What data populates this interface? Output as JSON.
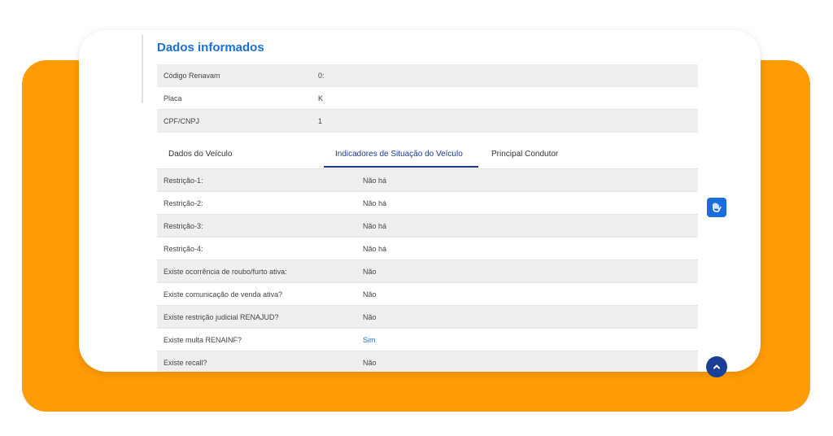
{
  "header": {
    "title": "Dados informados"
  },
  "info_rows": [
    {
      "label": "Código Renavam",
      "value": "0:"
    },
    {
      "label": "Placa",
      "value": "K"
    },
    {
      "label": "CPF/CNPJ",
      "value": "1"
    }
  ],
  "tabs": [
    {
      "label": "Dados do Veículo"
    },
    {
      "label": "Indicadores de Situação do Veículo"
    },
    {
      "label": "Principal Condutor"
    }
  ],
  "indicators": [
    {
      "label": "Restrição-1:",
      "value": "Não há"
    },
    {
      "label": "Restrição-2:",
      "value": "Não há"
    },
    {
      "label": "Restrição-3:",
      "value": "Não há"
    },
    {
      "label": "Restrição-4:",
      "value": "Não há"
    },
    {
      "label": "Existe ocorrência de roubo/furto ativa:",
      "value": "Não"
    },
    {
      "label": "Existe comunicação de venda ativa?",
      "value": "Não"
    },
    {
      "label": "Existe restrição judicial RENAJUD?",
      "value": "Não"
    },
    {
      "label": "Existe multa RENAINF?",
      "value": "Sim"
    },
    {
      "label": "Existe recall?",
      "value": "Não"
    }
  ],
  "colors": {
    "accent": "#1c6fd8",
    "brand_orange": "#ff9b05",
    "tab_active": "#1b3a8c"
  },
  "icons": {
    "accessibility": "hand-sign-icon",
    "scroll_top": "chevron-up-icon"
  }
}
